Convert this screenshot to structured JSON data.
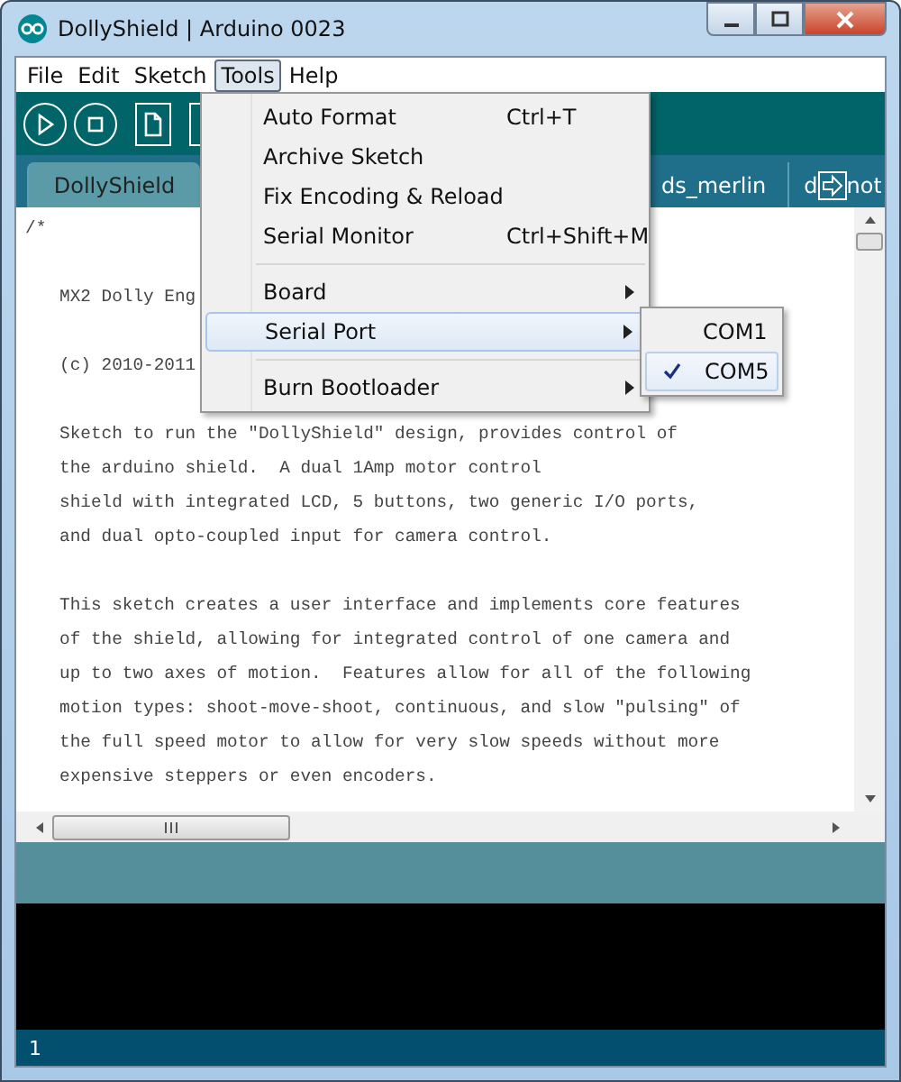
{
  "window": {
    "title": "DollyShield | Arduino 0023"
  },
  "menu_bar": [
    {
      "label": "File",
      "selected": false
    },
    {
      "label": "Edit",
      "selected": false
    },
    {
      "label": "Sketch",
      "selected": false
    },
    {
      "label": "Tools",
      "selected": true
    },
    {
      "label": "Help",
      "selected": false
    }
  ],
  "tabs": [
    {
      "label": "DollyShield",
      "selected": true
    },
    {
      "label": "ds_merlin",
      "selected": false
    }
  ],
  "last_tab": {
    "label_start": "d",
    "label_end": "not"
  },
  "editor_lines": [
    {
      "kind": "delimiter",
      "text": "/*"
    },
    {
      "kind": "blank"
    },
    {
      "kind": "code",
      "text": "MX2 Dolly Eng"
    },
    {
      "kind": "blank"
    },
    {
      "kind": "code",
      "text": "(c) 2010-2011"
    },
    {
      "kind": "blank"
    },
    {
      "kind": "code",
      "text": "Sketch to run the \"DollyShield\" design, provides control of"
    },
    {
      "kind": "code",
      "text": "the arduino shield.  A dual 1Amp motor control"
    },
    {
      "kind": "code",
      "text": "shield with integrated LCD, 5 buttons, two generic I/O ports,"
    },
    {
      "kind": "code",
      "text": "and dual opto-coupled input for camera control."
    },
    {
      "kind": "blank"
    },
    {
      "kind": "code",
      "text": "This sketch creates a user interface and implements core features"
    },
    {
      "kind": "code",
      "text": "of the shield, allowing for integrated control of one camera and"
    },
    {
      "kind": "code",
      "text": "up to two axes of motion.  Features allow for all of the following"
    },
    {
      "kind": "code",
      "text": "motion types: shoot-move-shoot, continuous, and slow \"pulsing\" of"
    },
    {
      "kind": "code",
      "text": "the full speed motor to allow for very slow speeds without more"
    },
    {
      "kind": "code",
      "text": "expensive steppers or even encoders."
    }
  ],
  "tools_menu": [
    {
      "kind": "item",
      "label": "Auto Format",
      "shortcut": "Ctrl+T",
      "selected": false
    },
    {
      "kind": "item",
      "label": "Archive Sketch",
      "selected": false
    },
    {
      "kind": "item",
      "label": "Fix Encoding & Reload",
      "selected": false
    },
    {
      "kind": "item",
      "label": "Serial Monitor",
      "shortcut": "Ctrl+Shift+M",
      "selected": false
    },
    {
      "kind": "separator"
    },
    {
      "kind": "submenu",
      "label": "Board",
      "selected": false
    },
    {
      "kind": "submenu",
      "label": "Serial Port",
      "selected": true
    },
    {
      "kind": "separator"
    },
    {
      "kind": "submenu",
      "label": "Burn Bootloader",
      "selected": false
    }
  ],
  "serial_port_menu": [
    {
      "label": "COM1",
      "checked": false
    },
    {
      "label": "COM5",
      "checked": true
    }
  ],
  "status_bar": {
    "line": "1"
  }
}
